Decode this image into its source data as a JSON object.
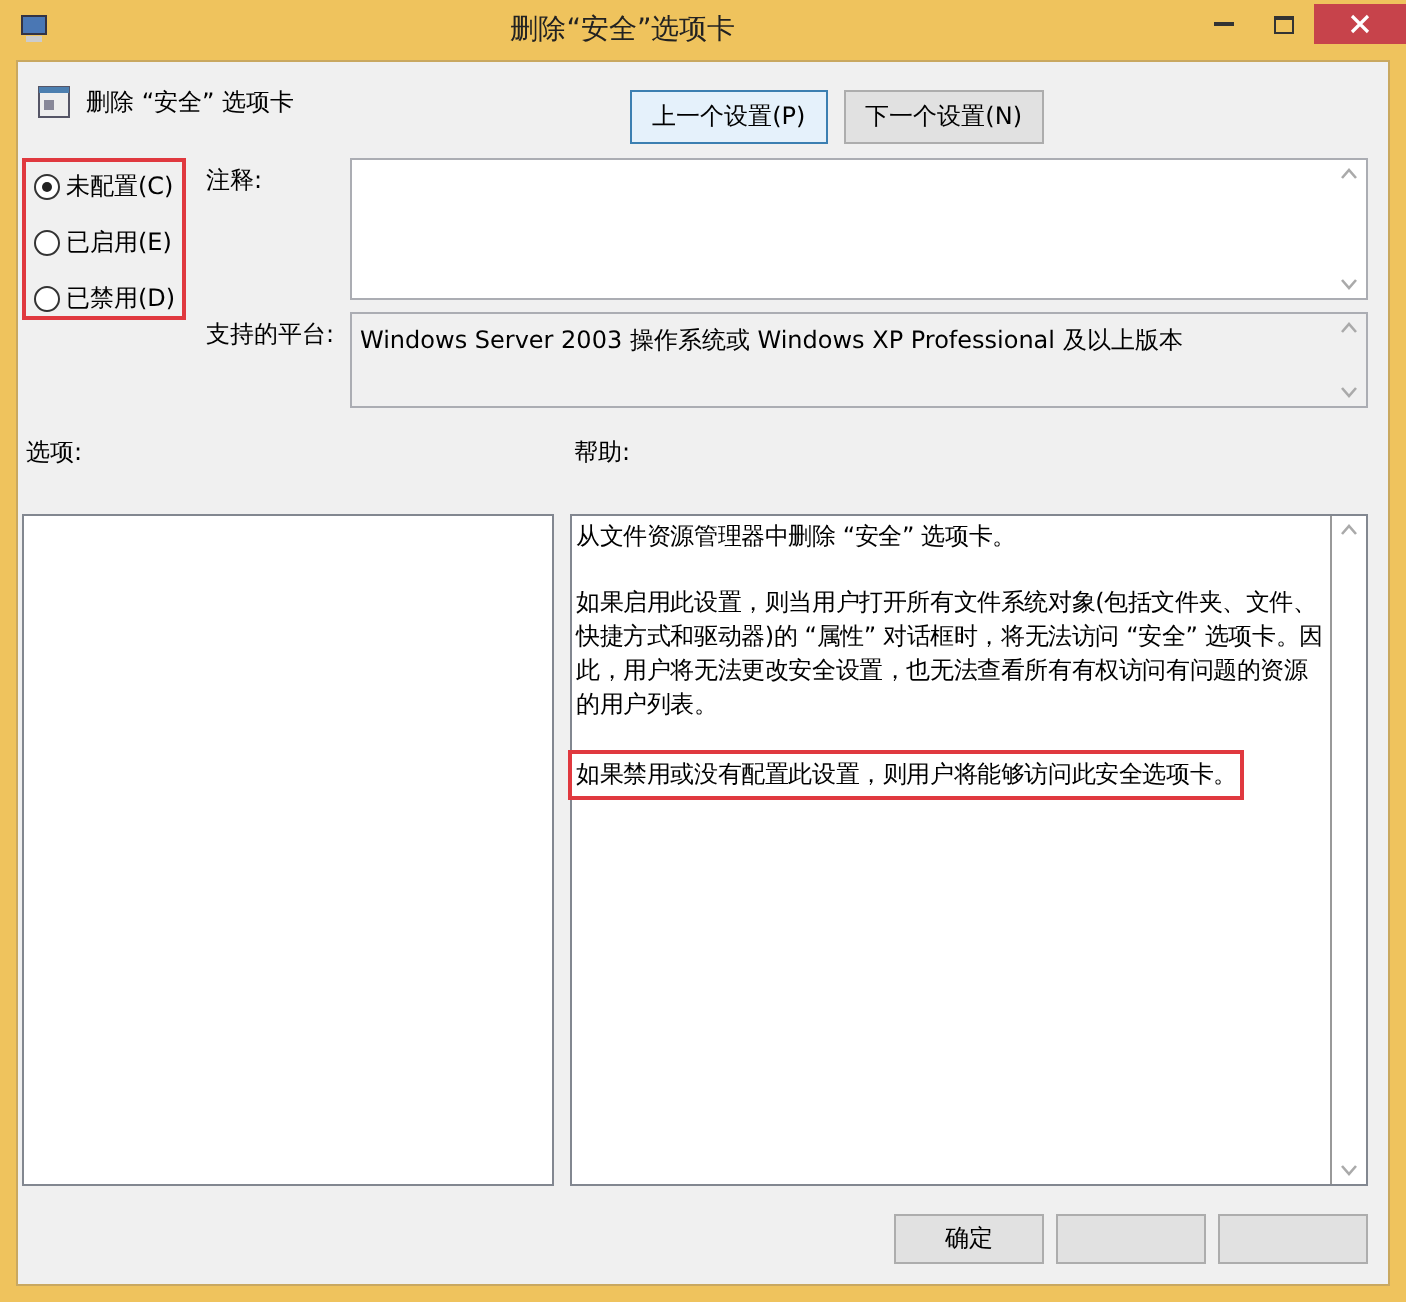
{
  "window": {
    "title": "删除“安全”选项卡"
  },
  "header": {
    "title": "删除 “安全” 选项卡"
  },
  "nav_buttons": [
    {
      "label": "上一个设置(P)",
      "selected": true
    },
    {
      "label": "下一个设置(N)",
      "selected": false
    }
  ],
  "options": [
    {
      "label": "未配置(C)",
      "selected": true
    },
    {
      "label": "已启用(E)",
      "selected": false
    },
    {
      "label": "已禁用(D)",
      "selected": false
    }
  ],
  "comment": {
    "label": "注释:"
  },
  "platform": {
    "label": "支持的平台:",
    "value": "Windows Server 2003 操作系统或 Windows XP Professional 及以上版本"
  },
  "options_panel": {
    "label": "选项:"
  },
  "help_panel": {
    "label": "帮助:",
    "paragraphs": [
      {
        "text": "从文件资源管理器中删除 “安全” 选项卡。",
        "highlighted": false
      },
      {
        "text": "如果启用此设置，则当用户打开所有文件系统对象(包括文件夹、文件、快捷方式和驱动器)的 “属性” 对话框时，将无法访问 “安全” 选项卡。因此，用户将无法更改安全设置，也无法查看所有有权访问有问题的资源的用户列表。",
        "highlighted": false
      },
      {
        "text": "如果禁用或没有配置此设置，则用户将能够访问此安全选项卡。",
        "highlighted": true
      }
    ]
  },
  "footer_buttons": [
    {
      "label": "确定"
    }
  ]
}
